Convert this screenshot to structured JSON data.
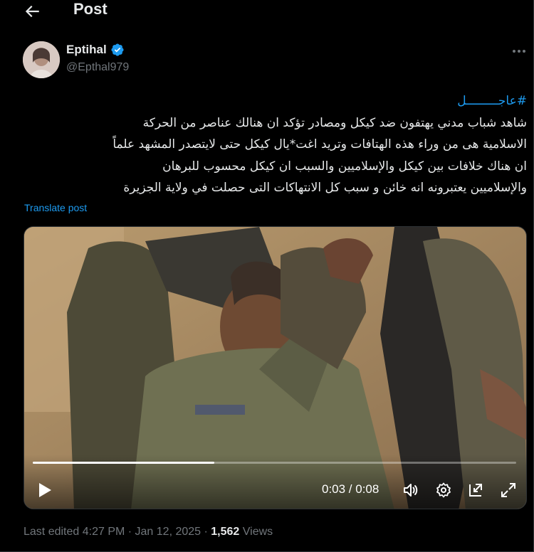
{
  "header": {
    "title": "Post"
  },
  "author": {
    "name": "Eptihal",
    "handle": "@Epthal979",
    "verified": true
  },
  "post": {
    "hashtag": "#عاجـــــــــل",
    "lines": [
      "شاهد شباب مدني يهتفون ضد كيكل ومصادر تؤكد ان هنالك عناصر من الحركة",
      "الاسلامية هى من وراء هذه الهتافات وتريد اغت*يال كيكل حتى لايتصدر المشهد علماً",
      "ان هناك خلافات بين كيكل والإسلاميين والسبب ان كيكل محسوب للبرهان",
      "والإسلاميين يعتبرونه انه خائن و سبب كل الانتهاكات التى حصلت في ولاية الجزيرة"
    ],
    "translate_label": "Translate post"
  },
  "video": {
    "elapsed": "0:03",
    "duration": "0:08",
    "progress_fraction": 0.375,
    "time_display": "0:03 / 0:08"
  },
  "footer": {
    "edited": "Last edited 4:27 PM · Jan 12, 2025 · ",
    "views_count": "1,562",
    "views_label": " Views"
  },
  "colors": {
    "accent": "#1d9bf0",
    "muted": "#71767b",
    "text": "#e7e9ea",
    "background": "#000000"
  },
  "icons": [
    "back-arrow-icon",
    "verified-badge-icon",
    "more-icon",
    "play-icon",
    "volume-icon",
    "settings-icon",
    "pop-out-icon",
    "fullscreen-icon"
  ]
}
